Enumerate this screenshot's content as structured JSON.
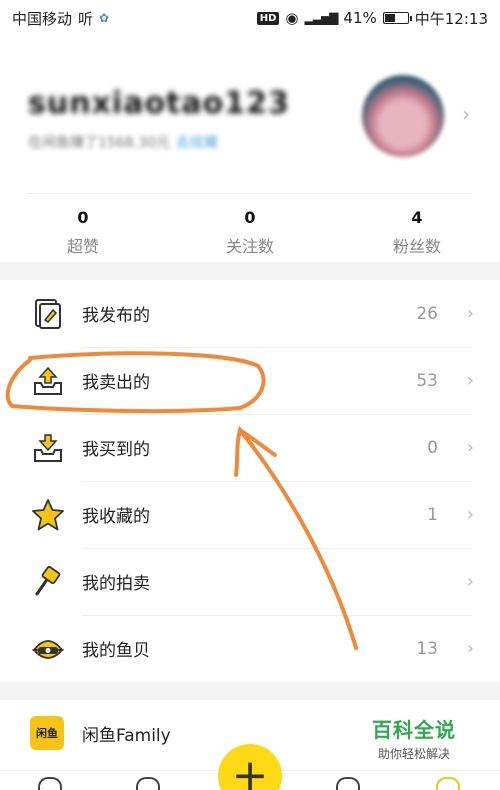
{
  "status_bar": {
    "carrier": "中国移动",
    "extra": "听",
    "battery_percent_text": "41%",
    "battery_level": 0.41,
    "hd": "HD",
    "time": "中午12:13"
  },
  "profile": {
    "username": "sunxiaotao123",
    "subline": "在闲鱼赚了1568.30元",
    "subline_tag": "去炫耀"
  },
  "stats": [
    {
      "value": "0",
      "label": "超赞"
    },
    {
      "value": "0",
      "label": "关注数"
    },
    {
      "value": "4",
      "label": "粉丝数"
    }
  ],
  "menu": [
    {
      "label": "我发布的",
      "count": "26",
      "icon": "published-icon"
    },
    {
      "label": "我卖出的",
      "count": "53",
      "icon": "sold-icon"
    },
    {
      "label": "我买到的",
      "count": "0",
      "icon": "bought-icon"
    },
    {
      "label": "我收藏的",
      "count": "1",
      "icon": "star-icon"
    },
    {
      "label": "我的拍卖",
      "count": "",
      "icon": "auction-icon"
    },
    {
      "label": "我的鱼贝",
      "count": "13",
      "icon": "shell-icon"
    }
  ],
  "family": {
    "label": "闲鱼Family",
    "icon_text": "闲鱼"
  },
  "watermark": {
    "title": "百科全说",
    "subtitle": "助你轻松解决"
  },
  "publish_symbol": "+",
  "colors": {
    "accent": "#ffd816",
    "annotation": "#f08a3a",
    "watermark": "#2fa84f"
  }
}
